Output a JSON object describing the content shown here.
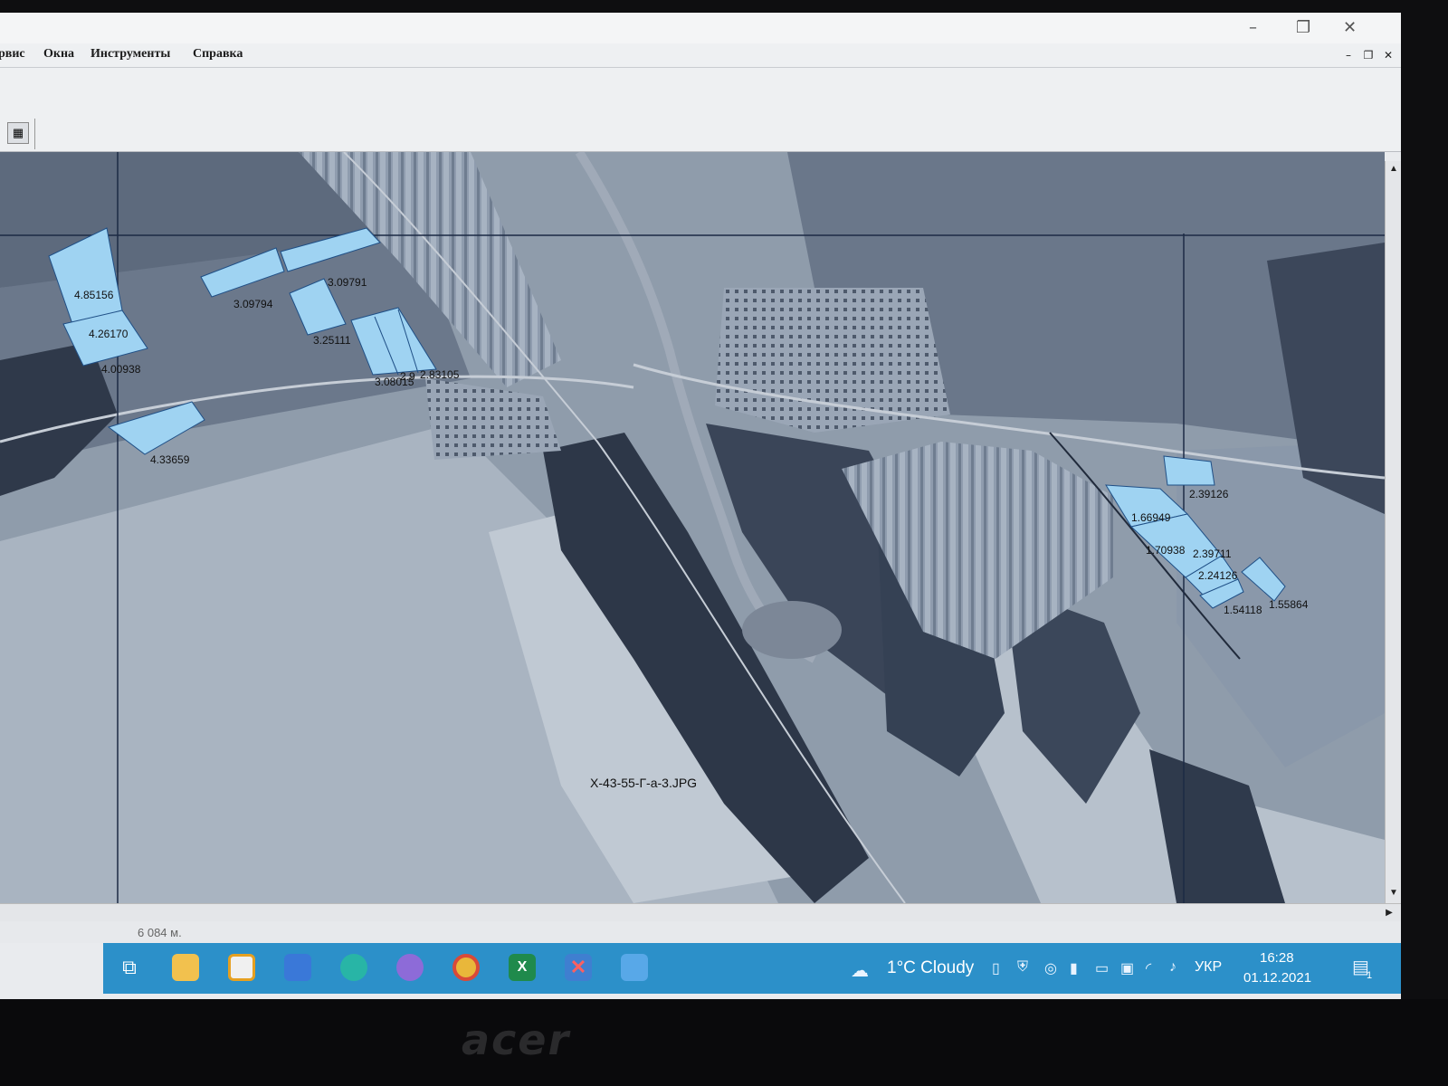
{
  "menu": {
    "items": [
      "рвис",
      "Окна",
      "Инструменты",
      "Справка"
    ]
  },
  "map": {
    "image_label": "X-43-55-Г-а-3.JPG",
    "parcels": [
      {
        "label": "4.85156"
      },
      {
        "label": "4.26170"
      },
      {
        "label": "4.00938"
      },
      {
        "label": "3.09794"
      },
      {
        "label": "3.09791"
      },
      {
        "label": "3.25111"
      },
      {
        "label": "3.08015"
      },
      {
        "label": "2.9"
      },
      {
        "label": "2.83105"
      },
      {
        "label": "4.33659"
      },
      {
        "label": "2.39126"
      },
      {
        "label": "1.66949"
      },
      {
        "label": "1.70938"
      },
      {
        "label": "2.39711"
      },
      {
        "label": "2.24126"
      },
      {
        "label": "1.54118"
      },
      {
        "label": "1.55864"
      }
    ],
    "colors": {
      "parcel_fill": "#9fd3f2",
      "parcel_stroke": "#1f4f86",
      "grid_line": "#1c2a44"
    }
  },
  "status": {
    "scale": "6 084 м."
  },
  "taskbar": {
    "icons": [
      "task-view-icon",
      "file-explorer-icon",
      "microsoft-store-icon",
      "mail-icon",
      "edge-icon",
      "viber-icon",
      "chrome-icon",
      "excel-icon",
      "gis-app-icon",
      "photos-icon"
    ],
    "weather": "1°C Cloudy",
    "language": "УКР",
    "time": "16:28",
    "date": "01.12.2021",
    "notification_count": "1"
  },
  "bezel": {
    "brand": "acer"
  }
}
